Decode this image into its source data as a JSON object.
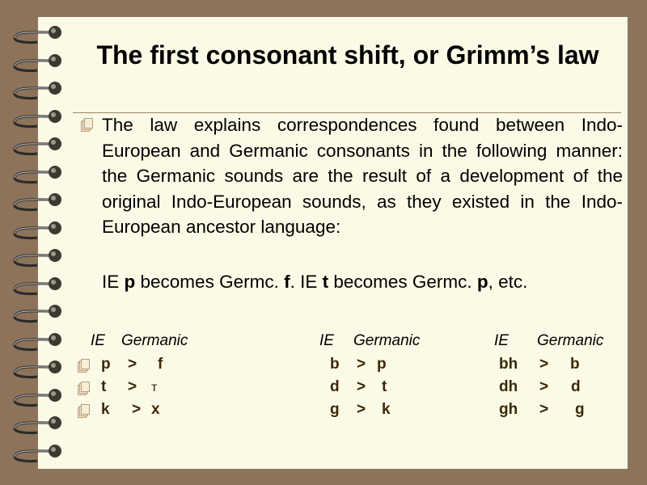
{
  "slide": {
    "title": "The first consonant shift, or Grimm’s law",
    "paragraph": "The law explains correspondences found between Indo-European and Germanic consonants in the following manner: the Germanic sounds are the result of a development of the original Indo-European sounds, as they existed in the Indo-European ancestor language:",
    "example": [
      {
        "text": "IE ",
        "bold": false
      },
      {
        "text": "p",
        "bold": true
      },
      {
        "text": " becomes Germc. ",
        "bold": false
      },
      {
        "text": "f",
        "bold": true
      },
      {
        "text": ". IE ",
        "bold": false
      },
      {
        "text": "t",
        "bold": true
      },
      {
        "text": " becomes Germc. ",
        "bold": false
      },
      {
        "text": "p",
        "bold": true
      },
      {
        "text": ", etc.",
        "bold": false
      }
    ],
    "table": {
      "groups": [
        {
          "ie_header": "IE",
          "germanic_header": "Germanic",
          "rows": [
            {
              "ie": "p",
              "sign": ">",
              "germanic": "f"
            },
            {
              "ie": "t",
              "sign": ">",
              "germanic": "т"
            },
            {
              "ie": "k",
              "sign": ">",
              "germanic": "x"
            }
          ]
        },
        {
          "ie_header": "IE",
          "germanic_header": "Germanic",
          "rows": [
            {
              "ie": "b",
              "sign": ">",
              "germanic": "p"
            },
            {
              "ie": "d",
              "sign": ">",
              "germanic": "t"
            },
            {
              "ie": "g",
              "sign": ">",
              "germanic": "k"
            }
          ]
        },
        {
          "ie_header": "IE",
          "germanic_header": "Germanic",
          "rows": [
            {
              "ie": "bh",
              "sign": ">",
              "germanic": "b"
            },
            {
              "ie": "dh",
              "sign": ">",
              "germanic": "d"
            },
            {
              "ie": "gh",
              "sign": ">",
              "germanic": "g"
            }
          ]
        }
      ]
    }
  }
}
